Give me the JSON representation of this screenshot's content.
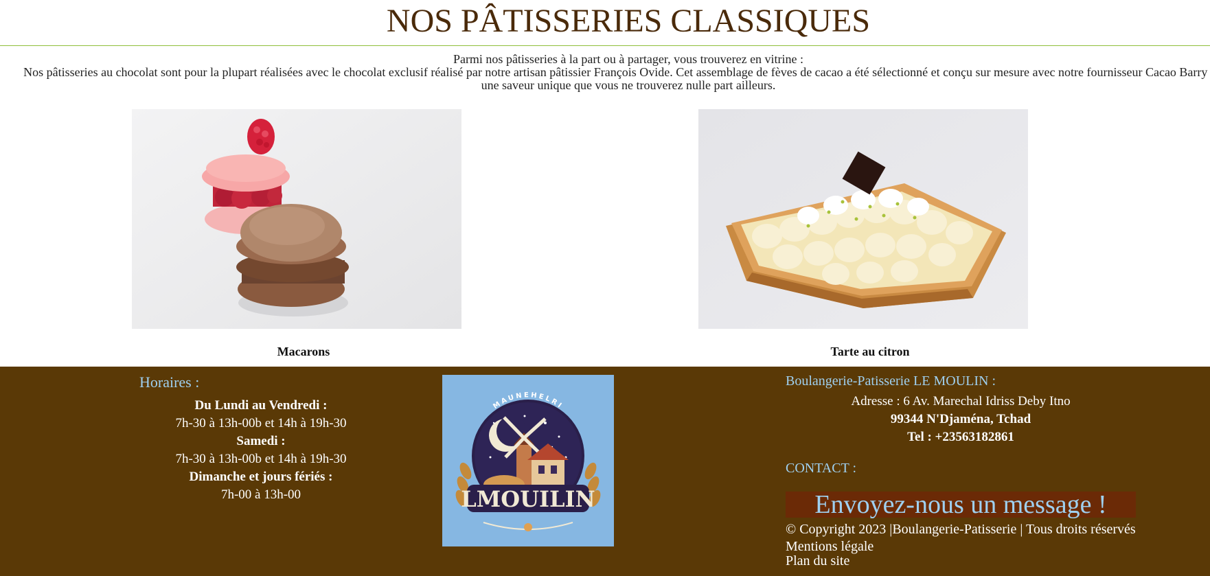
{
  "header": {
    "title": "NOS PÂTISSERIES CLASSIQUES"
  },
  "intro": {
    "line1": "Parmi nos pâtisseries à la part ou à partager, vous trouverez en vitrine :",
    "line2": "Nos pâtisseries au chocolat sont pour la plupart réalisées avec le chocolat exclusif réalisé par notre artisan pâtissier François Ovide. Cet assemblage de fèves de cacao a été sélectionné et conçu sur mesure avec notre fournisseur Cacao Barry pour",
    "line3": "une saveur unique que vous ne trouverez nulle part ailleurs."
  },
  "products": [
    {
      "name": "Macarons"
    },
    {
      "name": "Tarte au citron"
    }
  ],
  "footer": {
    "hours_title": "Horaires :",
    "weekday_label": "Du Lundi au Vendredi :",
    "weekday_hours": "7h-30 à 13h-00b et 14h à 19h-30",
    "saturday_label": "Samedi :",
    "saturday_hours": "7h-30 à 13h-00b et 14h à 19h-30",
    "sunday_label": "Dimanche et jours fériés :",
    "sunday_hours": "7h-00 à 13h-00",
    "logo_text": "LMOUILIN",
    "logo_arc_text": "MAUNEHELRI",
    "company_title": "Boulangerie-Patisserie LE MOULIN :",
    "address": "Adresse : 6 Av. Marechal Idriss Deby Itno",
    "city": "99344 N'Djaména, Tchad",
    "phone": "Tel : +23563182861",
    "contact_title": "CONTACT :",
    "cta_label": "Envoyez-nous un message !",
    "copyright": "© Copyright 2023 |Boulangerie-Patisserie | Tous droits réservés",
    "legal_link": "Mentions légale",
    "sitemap_link": "Plan du site"
  },
  "colors": {
    "title": "#4a2a0a",
    "rule": "#8fbf3a",
    "footer_bg": "#5a3906",
    "footer_accent": "#9fd0f0",
    "cta_bg": "#6b2a06",
    "logo_bg": "#86b7e2"
  }
}
